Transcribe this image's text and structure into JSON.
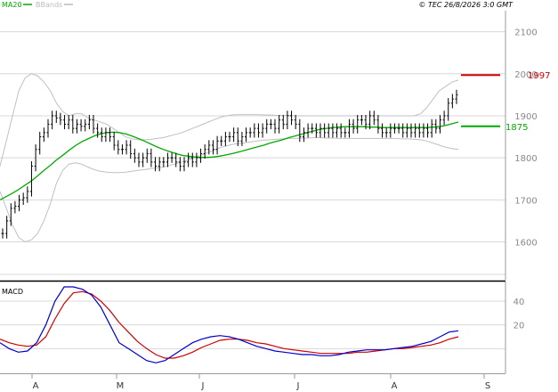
{
  "header": {
    "legend": [
      {
        "label": "MA20",
        "color": "#00aa00"
      },
      {
        "label": "BBands",
        "color": "#bbbbbb"
      }
    ],
    "copyright": "© TEC 26/8/2026 3:0 GMT"
  },
  "price_axis": {
    "ticks": [
      "2100",
      "1900",
      "1800",
      "1700",
      "1600"
    ],
    "hidden_tick": "2000"
  },
  "markers": {
    "resistance": {
      "label": "1997",
      "value": 1997,
      "color": "#cc0000"
    },
    "ma_level": {
      "label": "1875",
      "value": 1875,
      "color": "#00aa00"
    }
  },
  "macd_panel": {
    "title": "MACD",
    "ticks": [
      "40",
      "20"
    ]
  },
  "month_axis": {
    "labels": [
      "A",
      "M",
      "J",
      "J",
      "A",
      "S"
    ]
  },
  "chart_data": [
    {
      "type": "line",
      "subtype": "ohlc-price",
      "ylim": [
        1510,
        2150
      ],
      "price_closes": [
        1620,
        1650,
        1680,
        1685,
        1700,
        1705,
        1720,
        1780,
        1820,
        1850,
        1860,
        1880,
        1900,
        1895,
        1890,
        1880,
        1890,
        1870,
        1880,
        1875,
        1880,
        1890,
        1870,
        1860,
        1850,
        1860,
        1850,
        1830,
        1820,
        1820,
        1830,
        1810,
        1800,
        1790,
        1800,
        1810,
        1790,
        1780,
        1790,
        1790,
        1800,
        1800,
        1790,
        1780,
        1790,
        1800,
        1790,
        1800,
        1810,
        1820,
        1830,
        1820,
        1840,
        1840,
        1850,
        1850,
        1860,
        1840,
        1850,
        1860,
        1860,
        1870,
        1860,
        1870,
        1880,
        1880,
        1870,
        1890,
        1880,
        1900,
        1890,
        1880,
        1850,
        1860,
        1870,
        1870,
        1860,
        1870,
        1860,
        1870,
        1860,
        1870,
        1860,
        1860,
        1880,
        1870,
        1890,
        1890,
        1880,
        1900,
        1890,
        1870,
        1860,
        1860,
        1870,
        1870,
        1870,
        1860,
        1870,
        1860,
        1870,
        1860,
        1870,
        1860,
        1880,
        1870,
        1890,
        1900,
        1930,
        1940,
        1950
      ],
      "ma20": [
        1700,
        1708,
        1716,
        1725,
        1735,
        1745,
        1757,
        1770,
        1782,
        1795,
        1806,
        1818,
        1829,
        1838,
        1845,
        1852,
        1857,
        1860,
        1861,
        1860,
        1857,
        1852,
        1846,
        1840,
        1833,
        1826,
        1820,
        1815,
        1810,
        1806,
        1804,
        1802,
        1801,
        1801,
        1802,
        1804,
        1807,
        1810,
        1814,
        1818,
        1822,
        1826,
        1830,
        1835,
        1839,
        1843,
        1848,
        1852,
        1856,
        1860,
        1864,
        1868,
        1870,
        1872,
        1873,
        1874,
        1874,
        1874,
        1874,
        1873,
        1873,
        1872,
        1872,
        1872,
        1872,
        1872,
        1872,
        1872,
        1872,
        1873,
        1874,
        1877,
        1881,
        1885
      ],
      "bb_upper": [
        1780,
        1840,
        1900,
        1960,
        1990,
        2000,
        1995,
        1980,
        1960,
        1930,
        1910,
        1900,
        1905,
        1905,
        1895,
        1890,
        1885,
        1880,
        1870,
        1860,
        1850,
        1845,
        1843,
        1843,
        1844,
        1846,
        1848,
        1852,
        1856,
        1860,
        1866,
        1872,
        1878,
        1884,
        1890,
        1896,
        1900,
        1902,
        1903,
        1903,
        1903,
        1903,
        1902,
        1902,
        1901,
        1901,
        1901,
        1900,
        1900,
        1900,
        1900,
        1900,
        1900,
        1900,
        1900,
        1900,
        1900,
        1900,
        1900,
        1900,
        1900,
        1900,
        1900,
        1900,
        1900,
        1900,
        1900,
        1905,
        1920,
        1940,
        1960,
        1970,
        1980,
        1985
      ],
      "bb_lower": [
        1720,
        1680,
        1640,
        1610,
        1600,
        1605,
        1620,
        1650,
        1690,
        1740,
        1770,
        1785,
        1788,
        1785,
        1778,
        1772,
        1768,
        1766,
        1765,
        1765,
        1766,
        1768,
        1770,
        1772,
        1774,
        1776,
        1778,
        1782,
        1786,
        1790,
        1795,
        1800,
        1806,
        1812,
        1818,
        1824,
        1828,
        1832,
        1834,
        1836,
        1838,
        1840,
        1842,
        1843,
        1844,
        1845,
        1846,
        1846,
        1847,
        1847,
        1848,
        1848,
        1847,
        1847,
        1846,
        1846,
        1846,
        1846,
        1846,
        1846,
        1846,
        1846,
        1846,
        1846,
        1845,
        1845,
        1844,
        1843,
        1840,
        1835,
        1830,
        1825,
        1822,
        1820
      ]
    },
    {
      "type": "line",
      "subtype": "macd",
      "ylim": [
        -20,
        55
      ],
      "macd": [
        5,
        0,
        -3,
        -2,
        5,
        20,
        40,
        52,
        52,
        50,
        45,
        35,
        20,
        5,
        0,
        -5,
        -10,
        -12,
        -10,
        -5,
        0,
        5,
        8,
        10,
        11,
        10,
        8,
        5,
        2,
        0,
        -2,
        -3,
        -4,
        -5,
        -5,
        -6,
        -6,
        -5,
        -3,
        -2,
        -1,
        -1,
        -1,
        0,
        1,
        2,
        4,
        6,
        10,
        14,
        15
      ],
      "signal": [
        8,
        5,
        3,
        2,
        3,
        10,
        25,
        38,
        47,
        48,
        46,
        40,
        32,
        22,
        14,
        6,
        0,
        -5,
        -8,
        -8,
        -6,
        -3,
        1,
        4,
        7,
        8,
        8,
        7,
        5,
        4,
        2,
        0,
        -1,
        -2,
        -3,
        -4,
        -4,
        -4,
        -4,
        -3,
        -3,
        -2,
        -1,
        0,
        0,
        1,
        2,
        3,
        5,
        8,
        10
      ]
    }
  ]
}
